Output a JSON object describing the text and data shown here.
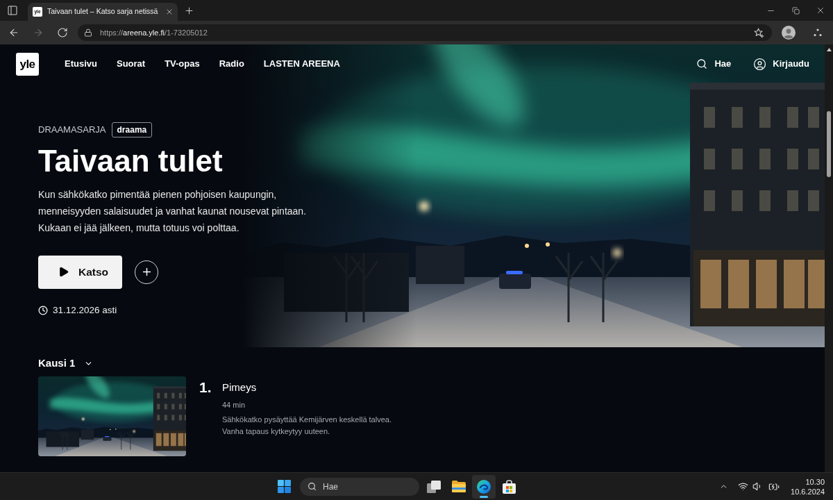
{
  "browser": {
    "tabs": [
      {
        "favicon": "yle",
        "title": "Taivaan tulet – Katso sarja netissä",
        "selected": true
      }
    ],
    "nav_buttons": [
      {
        "kind": "back",
        "disabled": false
      },
      {
        "kind": "forward",
        "disabled": true
      },
      {
        "kind": "reload",
        "disabled": false
      }
    ],
    "address": {
      "scheme": "https://",
      "host": "areena.yle.fi",
      "path": "/1-73205012"
    }
  },
  "site_header": {
    "logo": "yle",
    "links": [
      "Etusivu",
      "Suorat",
      "TV-opas",
      "Radio",
      "LASTEN AREENA"
    ],
    "search": "Hae",
    "login": "Kirjaudu"
  },
  "hero": {
    "category": "DRAAMASARJA",
    "genre_tag": "draama",
    "title": "Taivaan tulet",
    "description": "Kun sähkökatko pimentää pienen pohjoisen kaupungin, menneisyyden salaisuudet ja vanhat kaunat nousevat pintaan. Kukaan ei jää jälkeen, mutta totuus voi polttaa.",
    "watch_button": "Katso",
    "availability": "31.12.2026 asti"
  },
  "season": {
    "label": "Kausi 1",
    "episodes": [
      {
        "number": "1.",
        "title": "Pimeys",
        "duration": "44 min",
        "description": "Sähkökatko pysäyttää Kemijärven keskellä talvea. Vanha tapaus kytkeytyy uuteen."
      }
    ]
  },
  "taskbar": {
    "search": "Hae",
    "apps": [
      {
        "kind": "task_view",
        "selected": false
      },
      {
        "kind": "folder",
        "selected": false
      },
      {
        "kind": "browser",
        "selected": true
      },
      {
        "kind": "store",
        "selected": false
      }
    ],
    "time": "10.30",
    "date": "10.6.2024"
  }
}
